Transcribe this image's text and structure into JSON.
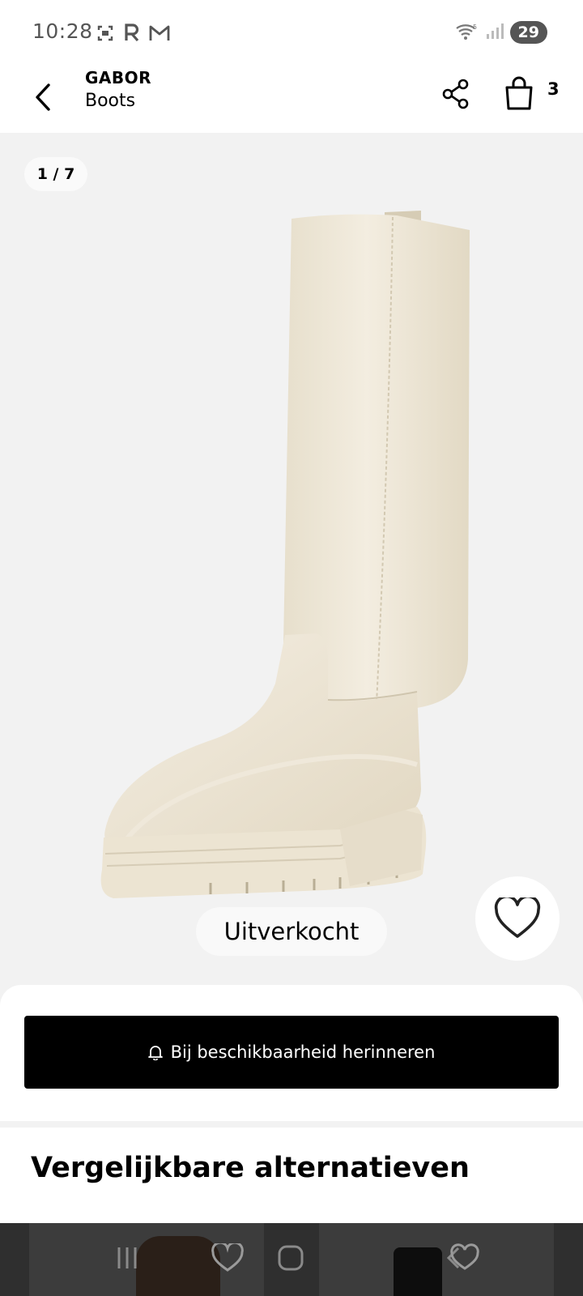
{
  "status_bar": {
    "time": "10:28",
    "left_icons": [
      "screenshot-icon",
      "r-app-icon",
      "gmail-icon"
    ],
    "battery": "29"
  },
  "app_bar": {
    "brand": "GABOR",
    "category": "Boots",
    "cart_count": "3"
  },
  "gallery": {
    "counter": "1 / 7",
    "sold_out_label": "Uitverkocht",
    "product_color": "#ece4d2"
  },
  "actions": {
    "notify_label": "Bij beschikbaarheid herinneren"
  },
  "alternatives": {
    "title": "Vergelijkbare alternatieven"
  },
  "bottom_nav": {
    "icons": [
      "recent-apps-icon",
      "wishlist-nav-icon",
      "home-icon",
      "back-nav-icon"
    ]
  }
}
